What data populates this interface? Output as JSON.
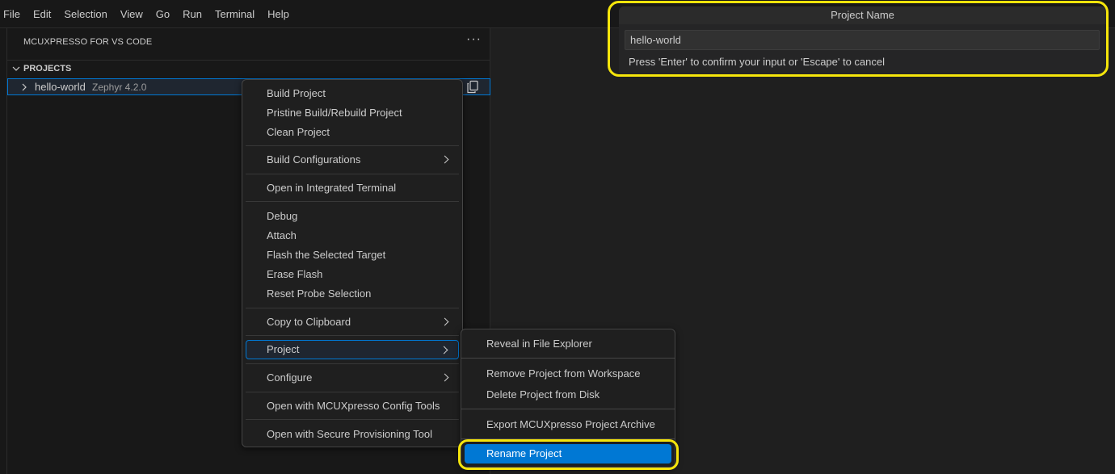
{
  "menubar": {
    "items": [
      "File",
      "Edit",
      "Selection",
      "View",
      "Go",
      "Run",
      "Terminal",
      "Help"
    ]
  },
  "sidebar": {
    "title": "MCUXPRESSO FOR VS CODE",
    "more": "···",
    "section": "PROJECTS",
    "project": {
      "name": "hello-world",
      "version": "Zephyr 4.2.0"
    }
  },
  "context_menu": {
    "build_project": "Build Project",
    "pristine_build": "Pristine Build/Rebuild Project",
    "clean_project": "Clean Project",
    "build_configurations": "Build Configurations",
    "open_terminal": "Open in Integrated Terminal",
    "debug": "Debug",
    "attach": "Attach",
    "flash_target": "Flash the Selected Target",
    "erase_flash": "Erase Flash",
    "reset_probe": "Reset Probe Selection",
    "copy_clipboard": "Copy to Clipboard",
    "project": "Project",
    "configure": "Configure",
    "open_config_tools": "Open with MCUXpresso Config Tools",
    "open_secure_prov": "Open with Secure Provisioning Tool"
  },
  "submenu": {
    "reveal": "Reveal in File Explorer",
    "remove": "Remove Project from Workspace",
    "delete": "Delete Project from Disk",
    "export": "Export MCUXpresso Project Archive",
    "rename": "Rename Project"
  },
  "quick_input": {
    "title": "Project Name",
    "value": "hello-world",
    "message": "Press 'Enter' to confirm your input or 'Escape' to cancel"
  },
  "colors": {
    "accent": "#0078d4",
    "highlight": "#f5e50b"
  }
}
